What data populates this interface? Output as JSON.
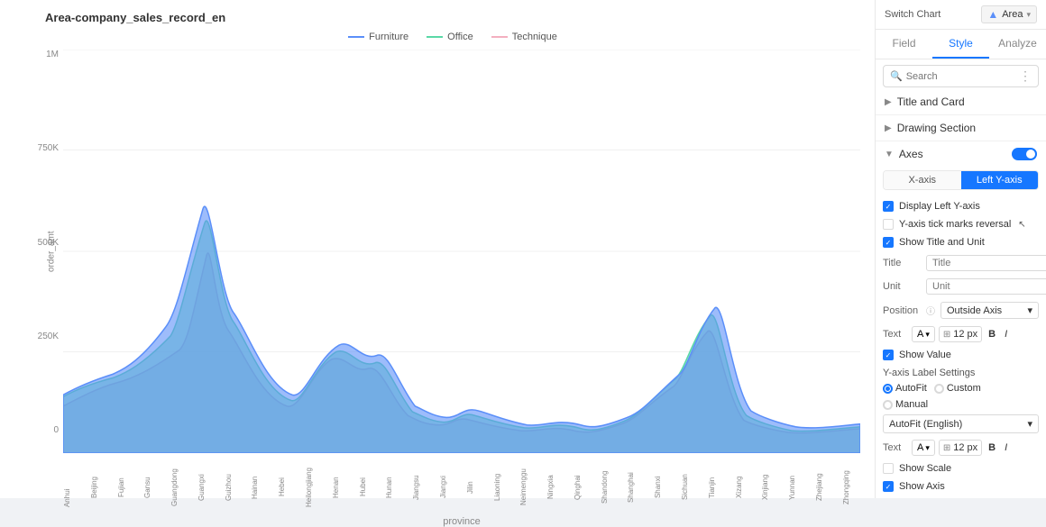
{
  "chart": {
    "title": "Area-company_sales_record_en",
    "y_axis_label": "order_amt",
    "x_axis_label": "province",
    "legend": [
      {
        "name": "Furniture",
        "color": "#5b8ff9",
        "type": "dashed"
      },
      {
        "name": "Office",
        "color": "#5ad8a6",
        "type": "dashed"
      },
      {
        "name": "Technique",
        "color": "#f6c3d0",
        "type": "dashed"
      }
    ],
    "y_ticks": [
      "1M",
      "750K",
      "500K",
      "250K",
      "0"
    ],
    "x_labels": [
      "Anhui",
      "Beijing",
      "Fujian",
      "Gansu",
      "Guangdong",
      "Guangxi",
      "Guizhou",
      "Hainan",
      "Hebei",
      "Heilongjiang",
      "Henan",
      "Hubei",
      "Hunan",
      "Jiangsu",
      "Jiangxi",
      "Jilin",
      "Liaoning",
      "Neimenggu",
      "Ningxia",
      "Qinghai",
      "Shandong",
      "Shanghai",
      "Shanxi",
      "Sichuan",
      "Tianjin",
      "Xizang",
      "Xinjiang",
      "Yunnan",
      "Zhejiang",
      "Zhongqing"
    ]
  },
  "panel": {
    "switch_chart_label": "Switch Chart",
    "chart_type": "Area",
    "tabs": [
      "Field",
      "Style",
      "Analyze"
    ],
    "active_tab": "Style",
    "search_placeholder": "Search",
    "sections": {
      "title_and_card": "Title and Card",
      "drawing_section": "Drawing Section",
      "axes": "Axes"
    },
    "axes_tabs": [
      "X-axis",
      "Left Y-axis"
    ],
    "active_axes_tab": "Left Y-axis",
    "checkboxes": {
      "display_left_yaxis": {
        "label": "Display Left Y-axis",
        "checked": true
      },
      "yaxis_tick_reversal": {
        "label": "Y-axis tick marks reversal",
        "checked": false
      },
      "show_title_unit": {
        "label": "Show Title and Unit",
        "checked": true
      },
      "show_value": {
        "label": "Show Value",
        "checked": true
      },
      "show_scale": {
        "label": "Show Scale",
        "checked": false
      },
      "show_axis": {
        "label": "Show Axis",
        "checked": true
      }
    },
    "form": {
      "title_label": "Title",
      "title_placeholder": "Title",
      "unit_label": "Unit",
      "unit_placeholder": "Unit",
      "position_label": "Position",
      "position_value": "Outside Axis",
      "text_label": "Text",
      "text_font": "A",
      "text_size": "12",
      "text_unit": "px"
    },
    "yaxis_label_settings": "Y-axis Label Settings",
    "radio_options": [
      "AutoFit",
      "Custom",
      "Manual"
    ],
    "active_radio": "AutoFit",
    "autofit_select": "AutoFit (English)",
    "text2_label": "Text",
    "axes_toggle": true
  }
}
